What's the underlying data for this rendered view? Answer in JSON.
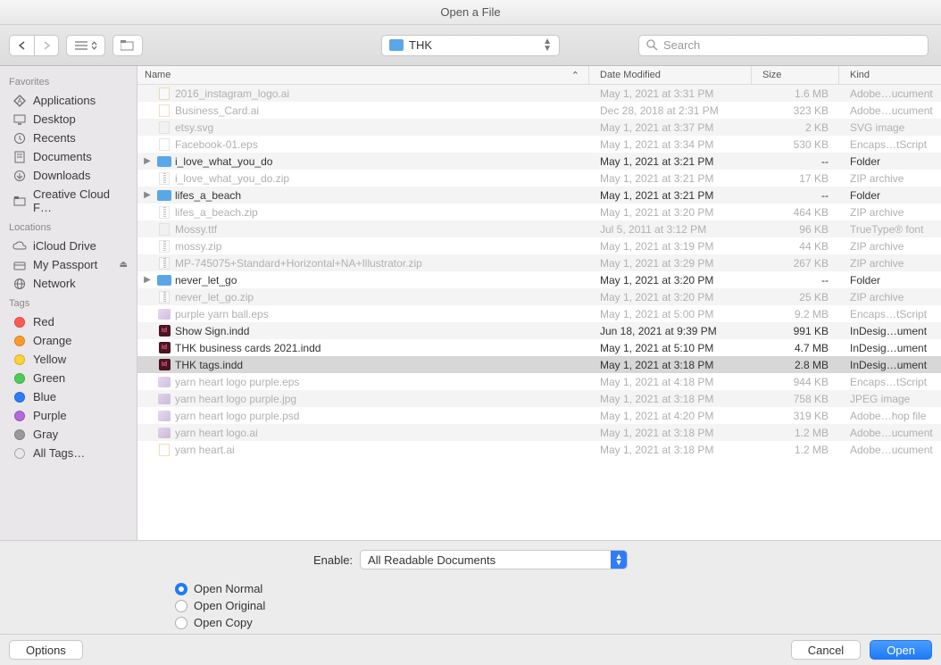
{
  "window_title": "Open a File",
  "path": "THK",
  "search_placeholder": "Search",
  "sidebar": {
    "sections": [
      {
        "header": "Favorites",
        "items": [
          {
            "label": "Applications",
            "icon": "app"
          },
          {
            "label": "Desktop",
            "icon": "desktop"
          },
          {
            "label": "Recents",
            "icon": "clock"
          },
          {
            "label": "Documents",
            "icon": "doc"
          },
          {
            "label": "Downloads",
            "icon": "down"
          },
          {
            "label": "Creative Cloud F…",
            "icon": "folder"
          }
        ]
      },
      {
        "header": "Locations",
        "items": [
          {
            "label": "iCloud Drive",
            "icon": "cloud"
          },
          {
            "label": "My Passport",
            "icon": "disk",
            "eject": true
          },
          {
            "label": "Network",
            "icon": "globe"
          }
        ]
      },
      {
        "header": "Tags",
        "items": [
          {
            "label": "Red",
            "color": "#ff5b52"
          },
          {
            "label": "Orange",
            "color": "#fc9b2d"
          },
          {
            "label": "Yellow",
            "color": "#fdd235"
          },
          {
            "label": "Green",
            "color": "#4bcd56"
          },
          {
            "label": "Blue",
            "color": "#2f7bfc"
          },
          {
            "label": "Purple",
            "color": "#b269da"
          },
          {
            "label": "Gray",
            "color": "#9a9a9a"
          },
          {
            "label": "All Tags…",
            "color": ""
          }
        ]
      }
    ]
  },
  "columns": {
    "name": "Name",
    "date": "Date Modified",
    "size": "Size",
    "kind": "Kind"
  },
  "files": [
    {
      "name": "2016_instagram_logo.ai",
      "date": "May 1, 2021 at 3:31 PM",
      "size": "1.6 MB",
      "kind": "Adobe…ucument",
      "dim": true,
      "icon": "ai"
    },
    {
      "name": "Business_Card.ai",
      "date": "Dec 28, 2018 at 2:31 PM",
      "size": "323 KB",
      "kind": "Adobe…ucument",
      "dim": true,
      "icon": "ai"
    },
    {
      "name": "etsy.svg",
      "date": "May 1, 2021 at 3:37 PM",
      "size": "2 KB",
      "kind": "SVG image",
      "dim": true,
      "icon": "generic"
    },
    {
      "name": "Facebook-01.eps",
      "date": "May 1, 2021 at 3:34 PM",
      "size": "530 KB",
      "kind": "Encaps…tScript",
      "dim": true,
      "icon": "file"
    },
    {
      "name": "i_love_what_you_do",
      "date": "May 1, 2021 at 3:21 PM",
      "size": "--",
      "kind": "Folder",
      "dim": false,
      "icon": "folder",
      "disclosure": true
    },
    {
      "name": "i_love_what_you_do.zip",
      "date": "May 1, 2021 at 3:21 PM",
      "size": "17 KB",
      "kind": "ZIP archive",
      "dim": true,
      "icon": "zip"
    },
    {
      "name": "lifes_a_beach",
      "date": "May 1, 2021 at 3:21 PM",
      "size": "--",
      "kind": "Folder",
      "dim": false,
      "icon": "folder",
      "disclosure": true
    },
    {
      "name": "lifes_a_beach.zip",
      "date": "May 1, 2021 at 3:20 PM",
      "size": "464 KB",
      "kind": "ZIP archive",
      "dim": true,
      "icon": "zip"
    },
    {
      "name": "Mossy.ttf",
      "date": "Jul 5, 2011 at 3:12 PM",
      "size": "96 KB",
      "kind": "TrueType® font",
      "dim": true,
      "icon": "generic"
    },
    {
      "name": "mossy.zip",
      "date": "May 1, 2021 at 3:19 PM",
      "size": "44 KB",
      "kind": "ZIP archive",
      "dim": true,
      "icon": "zip"
    },
    {
      "name": "MP-745075+Standard+Horizontal+NA+Illustrator.zip",
      "date": "May 1, 2021 at 3:29 PM",
      "size": "267 KB",
      "kind": "ZIP archive",
      "dim": true,
      "icon": "zip"
    },
    {
      "name": "never_let_go",
      "date": "May 1, 2021 at 3:20 PM",
      "size": "--",
      "kind": "Folder",
      "dim": false,
      "icon": "folder",
      "disclosure": true
    },
    {
      "name": "never_let_go.zip",
      "date": "May 1, 2021 at 3:20 PM",
      "size": "25 KB",
      "kind": "ZIP archive",
      "dim": true,
      "icon": "zip"
    },
    {
      "name": "purple yarn ball.eps",
      "date": "May 1, 2021 at 5:00 PM",
      "size": "9.2 MB",
      "kind": "Encaps…tScript",
      "dim": true,
      "icon": "eps"
    },
    {
      "name": "Show Sign.indd",
      "date": "Jun 18, 2021 at 9:39 PM",
      "size": "991 KB",
      "kind": "InDesig…ument",
      "dim": false,
      "icon": "indd"
    },
    {
      "name": "THK business cards 2021.indd",
      "date": "May 1, 2021 at 5:10 PM",
      "size": "4.7 MB",
      "kind": "InDesig…ument",
      "dim": false,
      "icon": "indd"
    },
    {
      "name": "THK tags.indd",
      "date": "May 1, 2021 at 3:18 PM",
      "size": "2.8 MB",
      "kind": "InDesig…ument",
      "dim": false,
      "icon": "indd",
      "selected": true
    },
    {
      "name": "yarn heart logo purple.eps",
      "date": "May 1, 2021 at 4:18 PM",
      "size": "944 KB",
      "kind": "Encaps…tScript",
      "dim": true,
      "icon": "eps"
    },
    {
      "name": "yarn heart logo purple.jpg",
      "date": "May 1, 2021 at 3:18 PM",
      "size": "758 KB",
      "kind": "JPEG image",
      "dim": true,
      "icon": "eps"
    },
    {
      "name": "yarn heart logo purple.psd",
      "date": "May 1, 2021 at 4:20 PM",
      "size": "319 KB",
      "kind": "Adobe…hop file",
      "dim": true,
      "icon": "eps"
    },
    {
      "name": "yarn heart logo.ai",
      "date": "May 1, 2021 at 3:18 PM",
      "size": "1.2 MB",
      "kind": "Adobe…ucument",
      "dim": true,
      "icon": "eps"
    },
    {
      "name": "yarn heart.ai",
      "date": "May 1, 2021 at 3:18 PM",
      "size": "1.2 MB",
      "kind": "Adobe…ucument",
      "dim": true,
      "icon": "ai"
    }
  ],
  "enable": {
    "label": "Enable:",
    "value": "All Readable Documents"
  },
  "radios": [
    {
      "label": "Open Normal",
      "checked": true
    },
    {
      "label": "Open Original",
      "checked": false
    },
    {
      "label": "Open Copy",
      "checked": false
    }
  ],
  "footer": {
    "options": "Options",
    "cancel": "Cancel",
    "open": "Open"
  }
}
